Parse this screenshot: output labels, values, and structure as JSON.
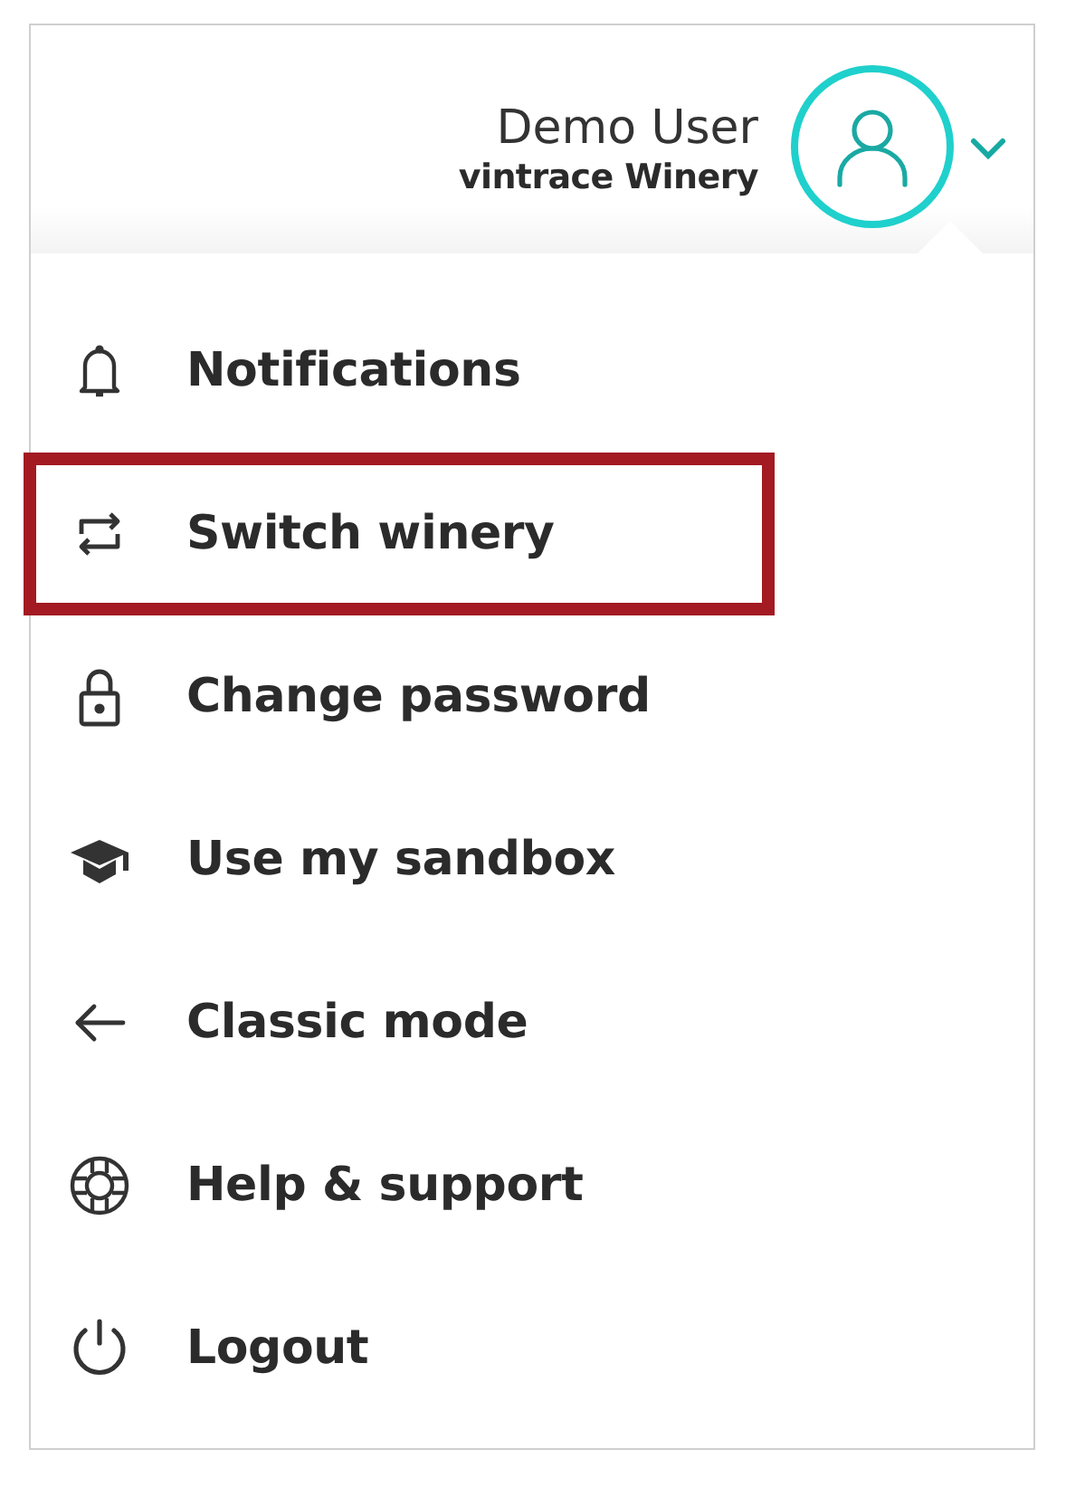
{
  "user": {
    "name": "Demo User",
    "organization": "vintrace Winery"
  },
  "menu": [
    {
      "kind": "bell",
      "label": "Notifications",
      "highlighted": false
    },
    {
      "kind": "switch",
      "label": "Switch winery",
      "highlighted": true
    },
    {
      "kind": "lock",
      "label": "Change password",
      "highlighted": false
    },
    {
      "kind": "cap",
      "label": "Use my sandbox",
      "highlighted": false
    },
    {
      "kind": "back",
      "label": "Classic mode",
      "highlighted": false
    },
    {
      "kind": "lifebuoy",
      "label": "Help & support",
      "highlighted": false
    },
    {
      "kind": "power",
      "label": "Logout",
      "highlighted": false
    }
  ]
}
